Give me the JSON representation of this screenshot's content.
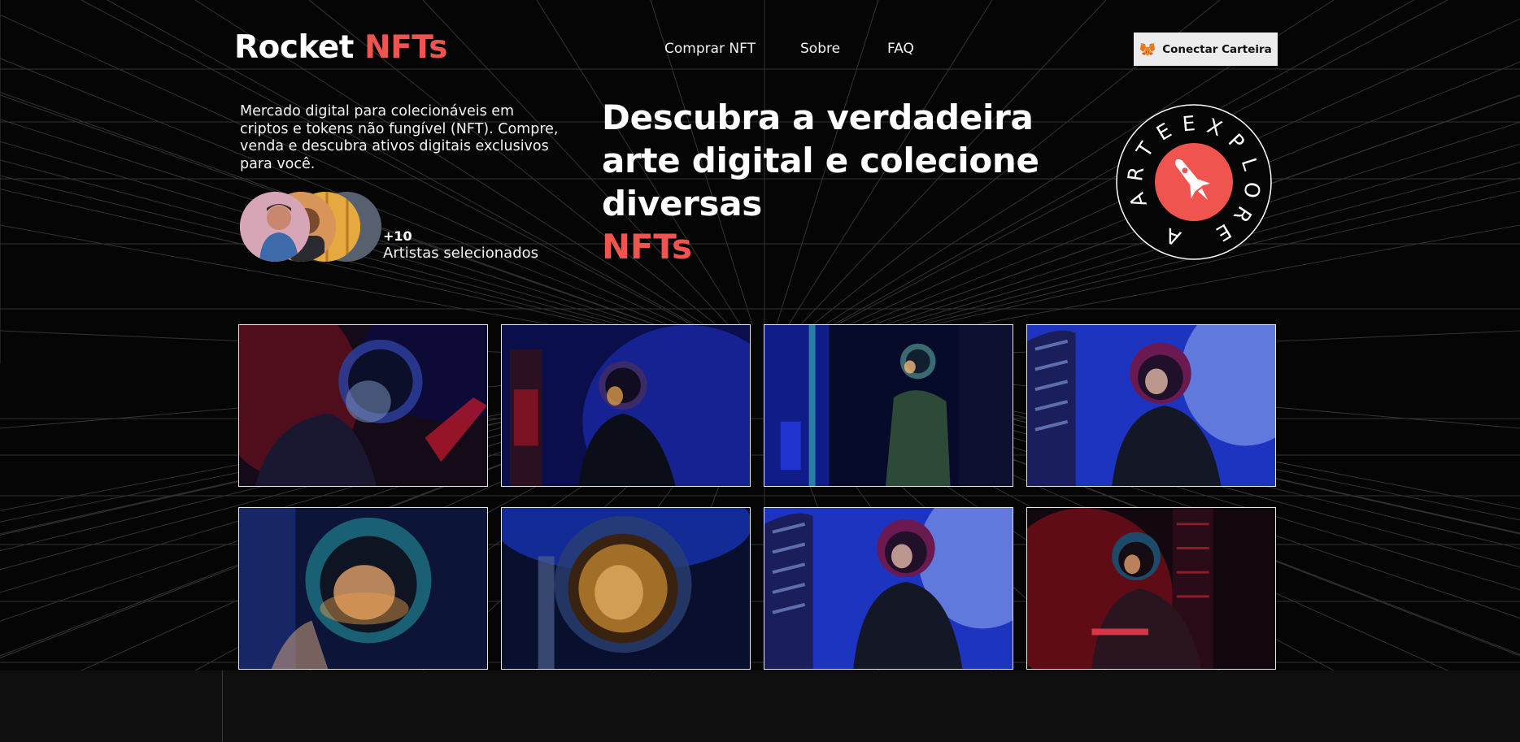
{
  "header": {
    "logo_main": "Rocket",
    "logo_accent": "NFTs",
    "nav": [
      "Comprar NFT",
      "Sobre",
      "FAQ"
    ],
    "wallet_button": "Conectar Carteira",
    "wallet_icon": "metamask-fox-icon"
  },
  "intro": {
    "text": "Mercado digital para colecionáveis em criptos e tokens não fungível (NFT). Compre, venda e descubra ativos digitais exclusivos para você."
  },
  "artists": {
    "count": "+10",
    "label": "Artistas selecionados"
  },
  "headline": {
    "text": "Descubra a verdadeira arte digital e colecione diversas",
    "accent": "NFTs"
  },
  "badge": {
    "ring_text": "EXPLORE A ARTE",
    "icon": "rocket-icon"
  },
  "gallery": {
    "items": [
      {
        "alt": "astronaut-portrait-1"
      },
      {
        "alt": "astronaut-portrait-2"
      },
      {
        "alt": "astronaut-portrait-3"
      },
      {
        "alt": "astronaut-portrait-4"
      },
      {
        "alt": "astronaut-portrait-5"
      },
      {
        "alt": "astronaut-portrait-6"
      },
      {
        "alt": "astronaut-portrait-7"
      },
      {
        "alt": "astronaut-portrait-8"
      }
    ]
  },
  "colors": {
    "accent": "#f0544f",
    "background": "#050505",
    "wallet_bg": "#ececec"
  }
}
